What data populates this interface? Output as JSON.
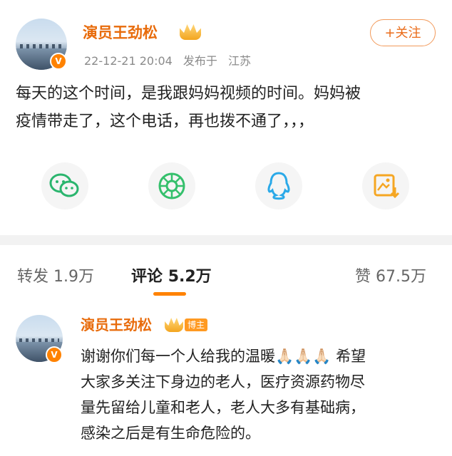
{
  "post": {
    "author": "演员王劲松",
    "date": "22-12-21 20:04",
    "location_prefix": "发布于",
    "location": "江苏",
    "follow_label": "+关注",
    "text_line1": "每天的这个时间，是我跟妈妈视频的时间。妈妈被",
    "text_line2": "疫情带走了，这个电话，再也拨不通了，，，",
    "verified_badge": "V"
  },
  "share": {
    "items": [
      {
        "icon": "wechat-icon",
        "color": "#2bb56e"
      },
      {
        "icon": "moments-icon",
        "color": "#35c06c"
      },
      {
        "icon": "qq-icon",
        "color": "#2aa9e8"
      },
      {
        "icon": "save-image-icon",
        "color": "#f5a623"
      }
    ]
  },
  "tabs": {
    "repost_label": "转发",
    "repost_count": "1.9万",
    "comment_label": "评论",
    "comment_count": "5.2万",
    "like_label": "赞",
    "like_count": "67.5万"
  },
  "comment": {
    "author": "演员王劲松",
    "tag": "博主",
    "line1": "谢谢你们每一个人给我的温暖🙏🏻🙏🏻🙏🏻 希望",
    "line2": "大家多关注下身边的老人，医疗资源药物尽",
    "line3": "量先留给儿童和老人，老人大多有基础病，",
    "line4": "感染之后是有生命危险的。"
  },
  "colors": {
    "accent": "#ff8200",
    "username": "#e86b0b",
    "meta": "#8a8a8a"
  }
}
